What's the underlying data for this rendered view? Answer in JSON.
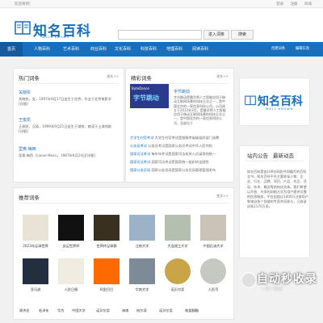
{
  "topbar": {
    "welcome": "欢迎来到!",
    "links": [
      "登录",
      "注册",
      "商城"
    ]
  },
  "logo": {
    "brand": "知名百科",
    "sub": "WELL KNOWN"
  },
  "search": {
    "value": "",
    "entry_button": "进入词条",
    "search_button": "搜索"
  },
  "nav": {
    "items": [
      "首页",
      "人物百科",
      "艺术百科",
      "商业百科",
      "文化百科",
      "科技百科",
      "地理百科",
      "阅读百科"
    ],
    "right": [
      "创建词条",
      "编辑实验"
    ]
  },
  "hot": {
    "title": "热门词条",
    "more": "更多>>",
    "entries": [
      {
        "name": "关晓彤",
        "desc": "关晓彤，女，1997年9月17日出生于北京，毕业于北京电影学[详细]"
      },
      {
        "name": "王俊凯",
        "desc": "王俊凯，汉族，1999年9月21日出生于湖南，就读于上海戏剧[详细]"
      },
      {
        "name": "里奥·梅西",
        "desc": "里奥·梅西（Lionel Messi，1987年6月24日[详细]"
      }
    ]
  },
  "featured": {
    "title": "精彩词条",
    "more": "更多>>",
    "image_text_top": "ByteDance",
    "image_text_main": "字节跳动",
    "item_title": "字节跳动",
    "item_desc": "字节跳动是最早将人工智能应用于移动互联网场景的科技企业之一，是中国北京的一家信息科技公司，公司成立于2012年3月，是最早将人工智能应用于移动互联网场景的科技企业之一，是中国北京的一家信息科技公司，总部位于",
    "news": [
      {
        "tag": "大学生村官考试",
        "text": "大学生村官考试是指报考省级组织部门选聘"
      },
      {
        "tag": "公务员考试",
        "text": "公务员考试是国家公务员考试中华人民共和"
      },
      {
        "tag": "国家司法考试",
        "text": "每年年考试是国家司法机关人员录用的统一"
      },
      {
        "tag": "国家司法考试",
        "text": "国家司法考试是国家统一组织的全国性"
      },
      {
        "tag": "国家公务员局",
        "text": "国家公务员局是国家公务员局管理管理发布"
      }
    ]
  },
  "right_logo": {
    "brand": "知名百科",
    "sub": "WELL KNOWN"
  },
  "announce": {
    "tab1": "站内公告",
    "tab2": "最新动态",
    "text": "知名百科是由100位网民共同编写的百科全书，知名百科平台主要收录人物、企业、行业、品牌、项目、产品、作品、活动、技术、概念等结构化实体。我们希望以开放、共享的网络方式为用户提供可靠的信息服务，平台由超过1000万注册用户和来自各个领域的专家共同参与，已收录词条1170万条。"
  },
  "recommend": {
    "title": "推荐词条",
    "more": "更多>>",
    "items": [
      "2023年足球世界",
      "女足世界杯",
      "世界杯足球赛",
      "江南大学",
      "大连理工大学",
      "中国石油大学",
      "亚马逊",
      "人民日报",
      "阿里巴巴",
      "华南大学",
      "诺贝尔奖",
      "人民币"
    ]
  },
  "bottom_links": [
    "周杰伦",
    "毛泽东",
    "华为",
    "中国大学",
    "诺贝尔奖",
    "海南",
    "哈尔滨",
    "诺贝尔奖",
    "唯爱翻翻"
  ],
  "watermark": {
    "big": "自动秒收录",
    "small": "一 天 一 收 录"
  }
}
